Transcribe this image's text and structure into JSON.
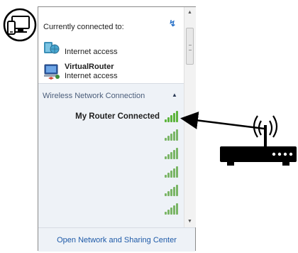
{
  "header": {
    "title": "Currently connected to:",
    "refresh_icon": "refresh-icon"
  },
  "connections": [
    {
      "name": "",
      "status": "Internet access",
      "icon": "network-globe-icon"
    },
    {
      "name": "VirtualRouter",
      "status": "Internet access",
      "icon": "network-computer-icon"
    }
  ],
  "wireless": {
    "section_label": "Wireless Network Connection",
    "networks": [
      {
        "name": "My Router",
        "status": "Connected",
        "signal_bars": 5
      },
      {
        "name": "",
        "status": "",
        "signal_bars": 5
      },
      {
        "name": "",
        "status": "",
        "signal_bars": 5
      },
      {
        "name": "",
        "status": "",
        "signal_bars": 5
      },
      {
        "name": "",
        "status": "",
        "signal_bars": 5
      },
      {
        "name": "",
        "status": "",
        "signal_bars": 5
      }
    ]
  },
  "footer": {
    "link": "Open Network and Sharing Center"
  },
  "annotations": {
    "router_icon": "wireless-router-icon",
    "device_icon": "computer-devices-icon"
  },
  "colors": {
    "accent_link": "#1e5aa8",
    "signal": "#5cb43c",
    "arrow": "#000000"
  }
}
